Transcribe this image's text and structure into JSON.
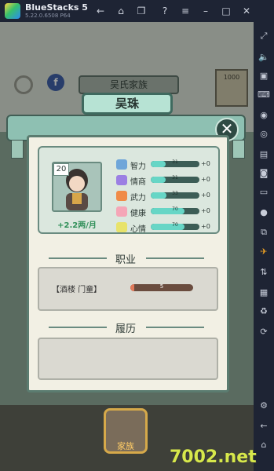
{
  "emulator": {
    "title": "BlueStacks 5",
    "version": "5.22.0.6508 P64"
  },
  "colors": {
    "accent": "#67d6c6",
    "panel_border": "#5b7c70",
    "income": "#2f8f58"
  },
  "game": {
    "clan_name": "吴氏家族",
    "character": {
      "name": "吴珠",
      "age": "20",
      "income": "+2.2两/月"
    },
    "stats": [
      {
        "label": "智力",
        "value": "31",
        "delta": "+0",
        "icon": "book-icon",
        "color": "#6fa6d9",
        "fill": 0.31
      },
      {
        "label": "情商",
        "value": "31",
        "delta": "+0",
        "icon": "star-icon",
        "color": "#9b7fe3",
        "fill": 0.31
      },
      {
        "label": "武力",
        "value": "33",
        "delta": "+0",
        "icon": "fist-icon",
        "color": "#f08b47",
        "fill": 0.33
      },
      {
        "label": "健康",
        "value": "70",
        "delta": "+0",
        "icon": "heart-icon",
        "color": "#f5a6b7",
        "fill": 0.7
      },
      {
        "label": "心情",
        "value": "70",
        "delta": "+0",
        "icon": "flower-icon",
        "color": "#e8e36a",
        "fill": 0.7
      }
    ],
    "sections": {
      "career": "职业",
      "history": "履历"
    },
    "career": {
      "name": "【酒楼 门童】",
      "value": "5",
      "fill": 0.06
    },
    "book_value": "1000",
    "family_button": "家族"
  },
  "watermark": "7002.net"
}
